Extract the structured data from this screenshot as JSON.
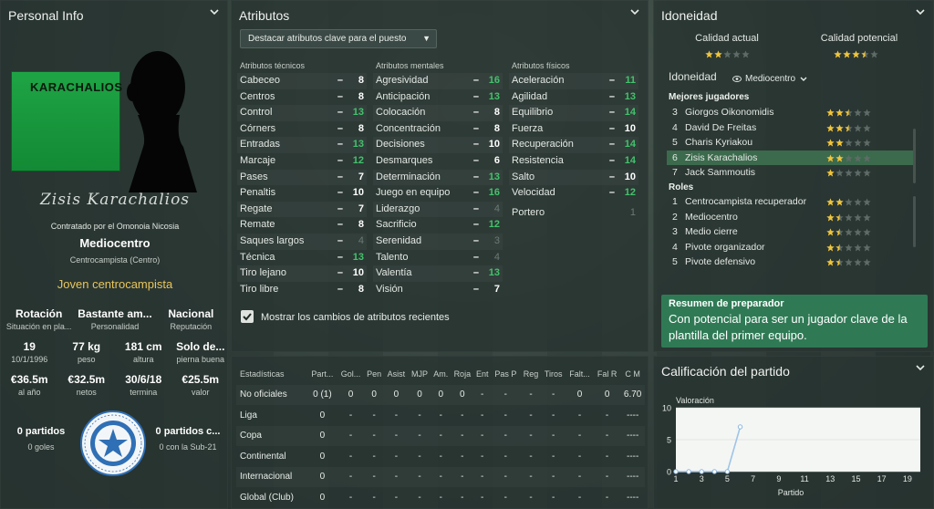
{
  "personal": {
    "title": "Personal Info",
    "card_name": "KARACHALIOS",
    "signature": "Zisis Karachalios",
    "contract": "Contratado por el Omonoia Nicosia",
    "position": "Mediocentro",
    "position_detail": "Centrocampista (Centro)",
    "role_desc": "Joven centrocampista",
    "row1": [
      {
        "value": "Rotación",
        "label": "Situación en pla..."
      },
      {
        "value": "Bastante am...",
        "label": "Personalidad"
      },
      {
        "value": "Nacional",
        "label": "Reputación"
      }
    ],
    "row2": [
      {
        "value": "19",
        "label": "10/1/1996"
      },
      {
        "value": "77 kg",
        "label": "peso"
      },
      {
        "value": "181 cm",
        "label": "altura"
      },
      {
        "value": "Solo de...",
        "label": "pierna buena"
      }
    ],
    "row3": [
      {
        "value": "€36.5m",
        "label": "al año"
      },
      {
        "value": "€32.5m",
        "label": "netos"
      },
      {
        "value": "30/6/18",
        "label": "termina"
      },
      {
        "value": "€25.5m",
        "label": "valor"
      }
    ],
    "left_stat": {
      "value": "0 partidos",
      "label": "0 goles"
    },
    "right_stat": {
      "value": "0 partidos c...",
      "label": "0 con la Sub-21"
    },
    "club_colors": {
      "badge": "#2f6fb5",
      "card": "#1ea445"
    }
  },
  "attributes": {
    "title": "Atributos",
    "highlight_dropdown": "Destacar atributos clave para el puesto",
    "columns": [
      {
        "header": "Atributos técnicos",
        "rows": [
          {
            "name": "Cabeceo",
            "value": "8",
            "style": "w"
          },
          {
            "name": "Centros",
            "value": "8",
            "style": "w"
          },
          {
            "name": "Control",
            "value": "13",
            "style": "g"
          },
          {
            "name": "Córners",
            "value": "8",
            "style": "w"
          },
          {
            "name": "Entradas",
            "value": "13",
            "style": "g"
          },
          {
            "name": "Marcaje",
            "value": "12",
            "style": "g"
          },
          {
            "name": "Pases",
            "value": "7",
            "style": "w"
          },
          {
            "name": "Penaltis",
            "value": "10",
            "style": "w"
          },
          {
            "name": "Regate",
            "value": "7",
            "style": "w"
          },
          {
            "name": "Remate",
            "value": "8",
            "style": "w"
          },
          {
            "name": "Saques largos",
            "value": "4",
            "style": "dim"
          },
          {
            "name": "Técnica",
            "value": "13",
            "style": "g"
          },
          {
            "name": "Tiro lejano",
            "value": "10",
            "style": "w"
          },
          {
            "name": "Tiro libre",
            "value": "8",
            "style": "w"
          }
        ]
      },
      {
        "header": "Atributos mentales",
        "rows": [
          {
            "name": "Agresividad",
            "value": "16",
            "style": "g"
          },
          {
            "name": "Anticipación",
            "value": "13",
            "style": "g"
          },
          {
            "name": "Colocación",
            "value": "8",
            "style": "w"
          },
          {
            "name": "Concentración",
            "value": "8",
            "style": "w"
          },
          {
            "name": "Decisiones",
            "value": "10",
            "style": "w"
          },
          {
            "name": "Desmarques",
            "value": "6",
            "style": "w"
          },
          {
            "name": "Determinación",
            "value": "13",
            "style": "g"
          },
          {
            "name": "Juego en equipo",
            "value": "16",
            "style": "g"
          },
          {
            "name": "Liderazgo",
            "value": "4",
            "style": "dim"
          },
          {
            "name": "Sacrificio",
            "value": "12",
            "style": "g"
          },
          {
            "name": "Serenidad",
            "value": "3",
            "style": "dim"
          },
          {
            "name": "Talento",
            "value": "4",
            "style": "dim"
          },
          {
            "name": "Valentía",
            "value": "13",
            "style": "g"
          },
          {
            "name": "Visión",
            "value": "7",
            "style": "w"
          }
        ]
      },
      {
        "header": "Atributos físicos",
        "rows": [
          {
            "name": "Aceleración",
            "value": "11",
            "style": "g"
          },
          {
            "name": "Agilidad",
            "value": "13",
            "style": "g"
          },
          {
            "name": "Equilibrio",
            "value": "14",
            "style": "g"
          },
          {
            "name": "Fuerza",
            "value": "10",
            "style": "w"
          },
          {
            "name": "Recuperación",
            "value": "14",
            "style": "g"
          },
          {
            "name": "Resistencia",
            "value": "14",
            "style": "g"
          },
          {
            "name": "Salto",
            "value": "10",
            "style": "w"
          },
          {
            "name": "Velocidad",
            "value": "12",
            "style": "g"
          }
        ],
        "extra": {
          "name": "Portero",
          "value": "1"
        }
      }
    ],
    "show_changes_label": "Mostrar los cambios de atributos recientes",
    "show_changes_checked": true
  },
  "stats": {
    "headers": [
      "Estadísticas",
      "Part...",
      "Gol...",
      "Pen",
      "Asist",
      "MJP",
      "Am.",
      "Roja",
      "Ent",
      "Pas P",
      "Reg",
      "Tiros",
      "Falt...",
      "Fal R",
      "C M"
    ],
    "rows": [
      [
        "No oficiales",
        "0 (1)",
        "0",
        "0",
        "0",
        "0",
        "0",
        "0",
        "-",
        "-",
        "-",
        "-",
        "0",
        "0",
        "6.70"
      ],
      [
        "Liga",
        "0",
        "-",
        "-",
        "-",
        "-",
        "-",
        "-",
        "-",
        "-",
        "-",
        "-",
        "-",
        "-",
        "----"
      ],
      [
        "Copa",
        "0",
        "-",
        "-",
        "-",
        "-",
        "-",
        "-",
        "-",
        "-",
        "-",
        "-",
        "-",
        "-",
        "----"
      ],
      [
        "Continental",
        "0",
        "-",
        "-",
        "-",
        "-",
        "-",
        "-",
        "-",
        "-",
        "-",
        "-",
        "-",
        "-",
        "----"
      ],
      [
        "Internacional",
        "0",
        "-",
        "-",
        "-",
        "-",
        "-",
        "-",
        "-",
        "-",
        "-",
        "-",
        "-",
        "-",
        "----"
      ],
      [
        "Global (Club)",
        "0",
        "-",
        "-",
        "-",
        "-",
        "-",
        "-",
        "-",
        "-",
        "-",
        "-",
        "-",
        "-",
        "----"
      ]
    ]
  },
  "suitability": {
    "title": "Idoneidad",
    "current_label": "Calidad actual",
    "current_stars": 2,
    "potential_label": "Calidad potencial",
    "potential_stars": 3.5,
    "subtitle": "Idoneidad",
    "role_select": "Mediocentro",
    "best_players_label": "Mejores jugadores",
    "best_players": [
      {
        "rank": "3",
        "name": "Giorgos Oikonomidis",
        "stars": 2.5
      },
      {
        "rank": "4",
        "name": "David De Freitas",
        "stars": 2.5
      },
      {
        "rank": "5",
        "name": "Charis Kyriakou",
        "stars": 2
      },
      {
        "rank": "6",
        "name": "Zisis Karachalios",
        "stars": 2
      },
      {
        "rank": "7",
        "name": "Jack Sammoutis",
        "stars": 1
      }
    ],
    "roles_label": "Roles",
    "roles": [
      {
        "rank": "1",
        "name": "Centrocampista recuperador",
        "stars": 2
      },
      {
        "rank": "2",
        "name": "Mediocentro",
        "stars": 1.5
      },
      {
        "rank": "3",
        "name": "Medio cierre",
        "stars": 1.5
      },
      {
        "rank": "4",
        "name": "Pivote organizador",
        "stars": 1.5
      },
      {
        "rank": "5",
        "name": "Pivote defensivo",
        "stars": 1.5
      }
    ],
    "coach_title": "Resumen de preparador",
    "coach_text": "Con potencial para ser un jugador clave de la plantilla del primer equipo."
  },
  "match_rating": {
    "title": "Calificación del partido",
    "chart_data": {
      "type": "line",
      "ylabel": "Valoración",
      "xlabel": "Partido",
      "ylim": [
        0,
        10
      ],
      "yticks": [
        0,
        5,
        10
      ],
      "xticks": [
        1,
        3,
        5,
        7,
        9,
        11,
        13,
        15,
        17,
        19
      ],
      "xlim": [
        1,
        20
      ],
      "x": [
        1,
        2,
        3,
        4,
        5,
        6
      ],
      "values": [
        0,
        0,
        0,
        0,
        0,
        7
      ]
    }
  }
}
